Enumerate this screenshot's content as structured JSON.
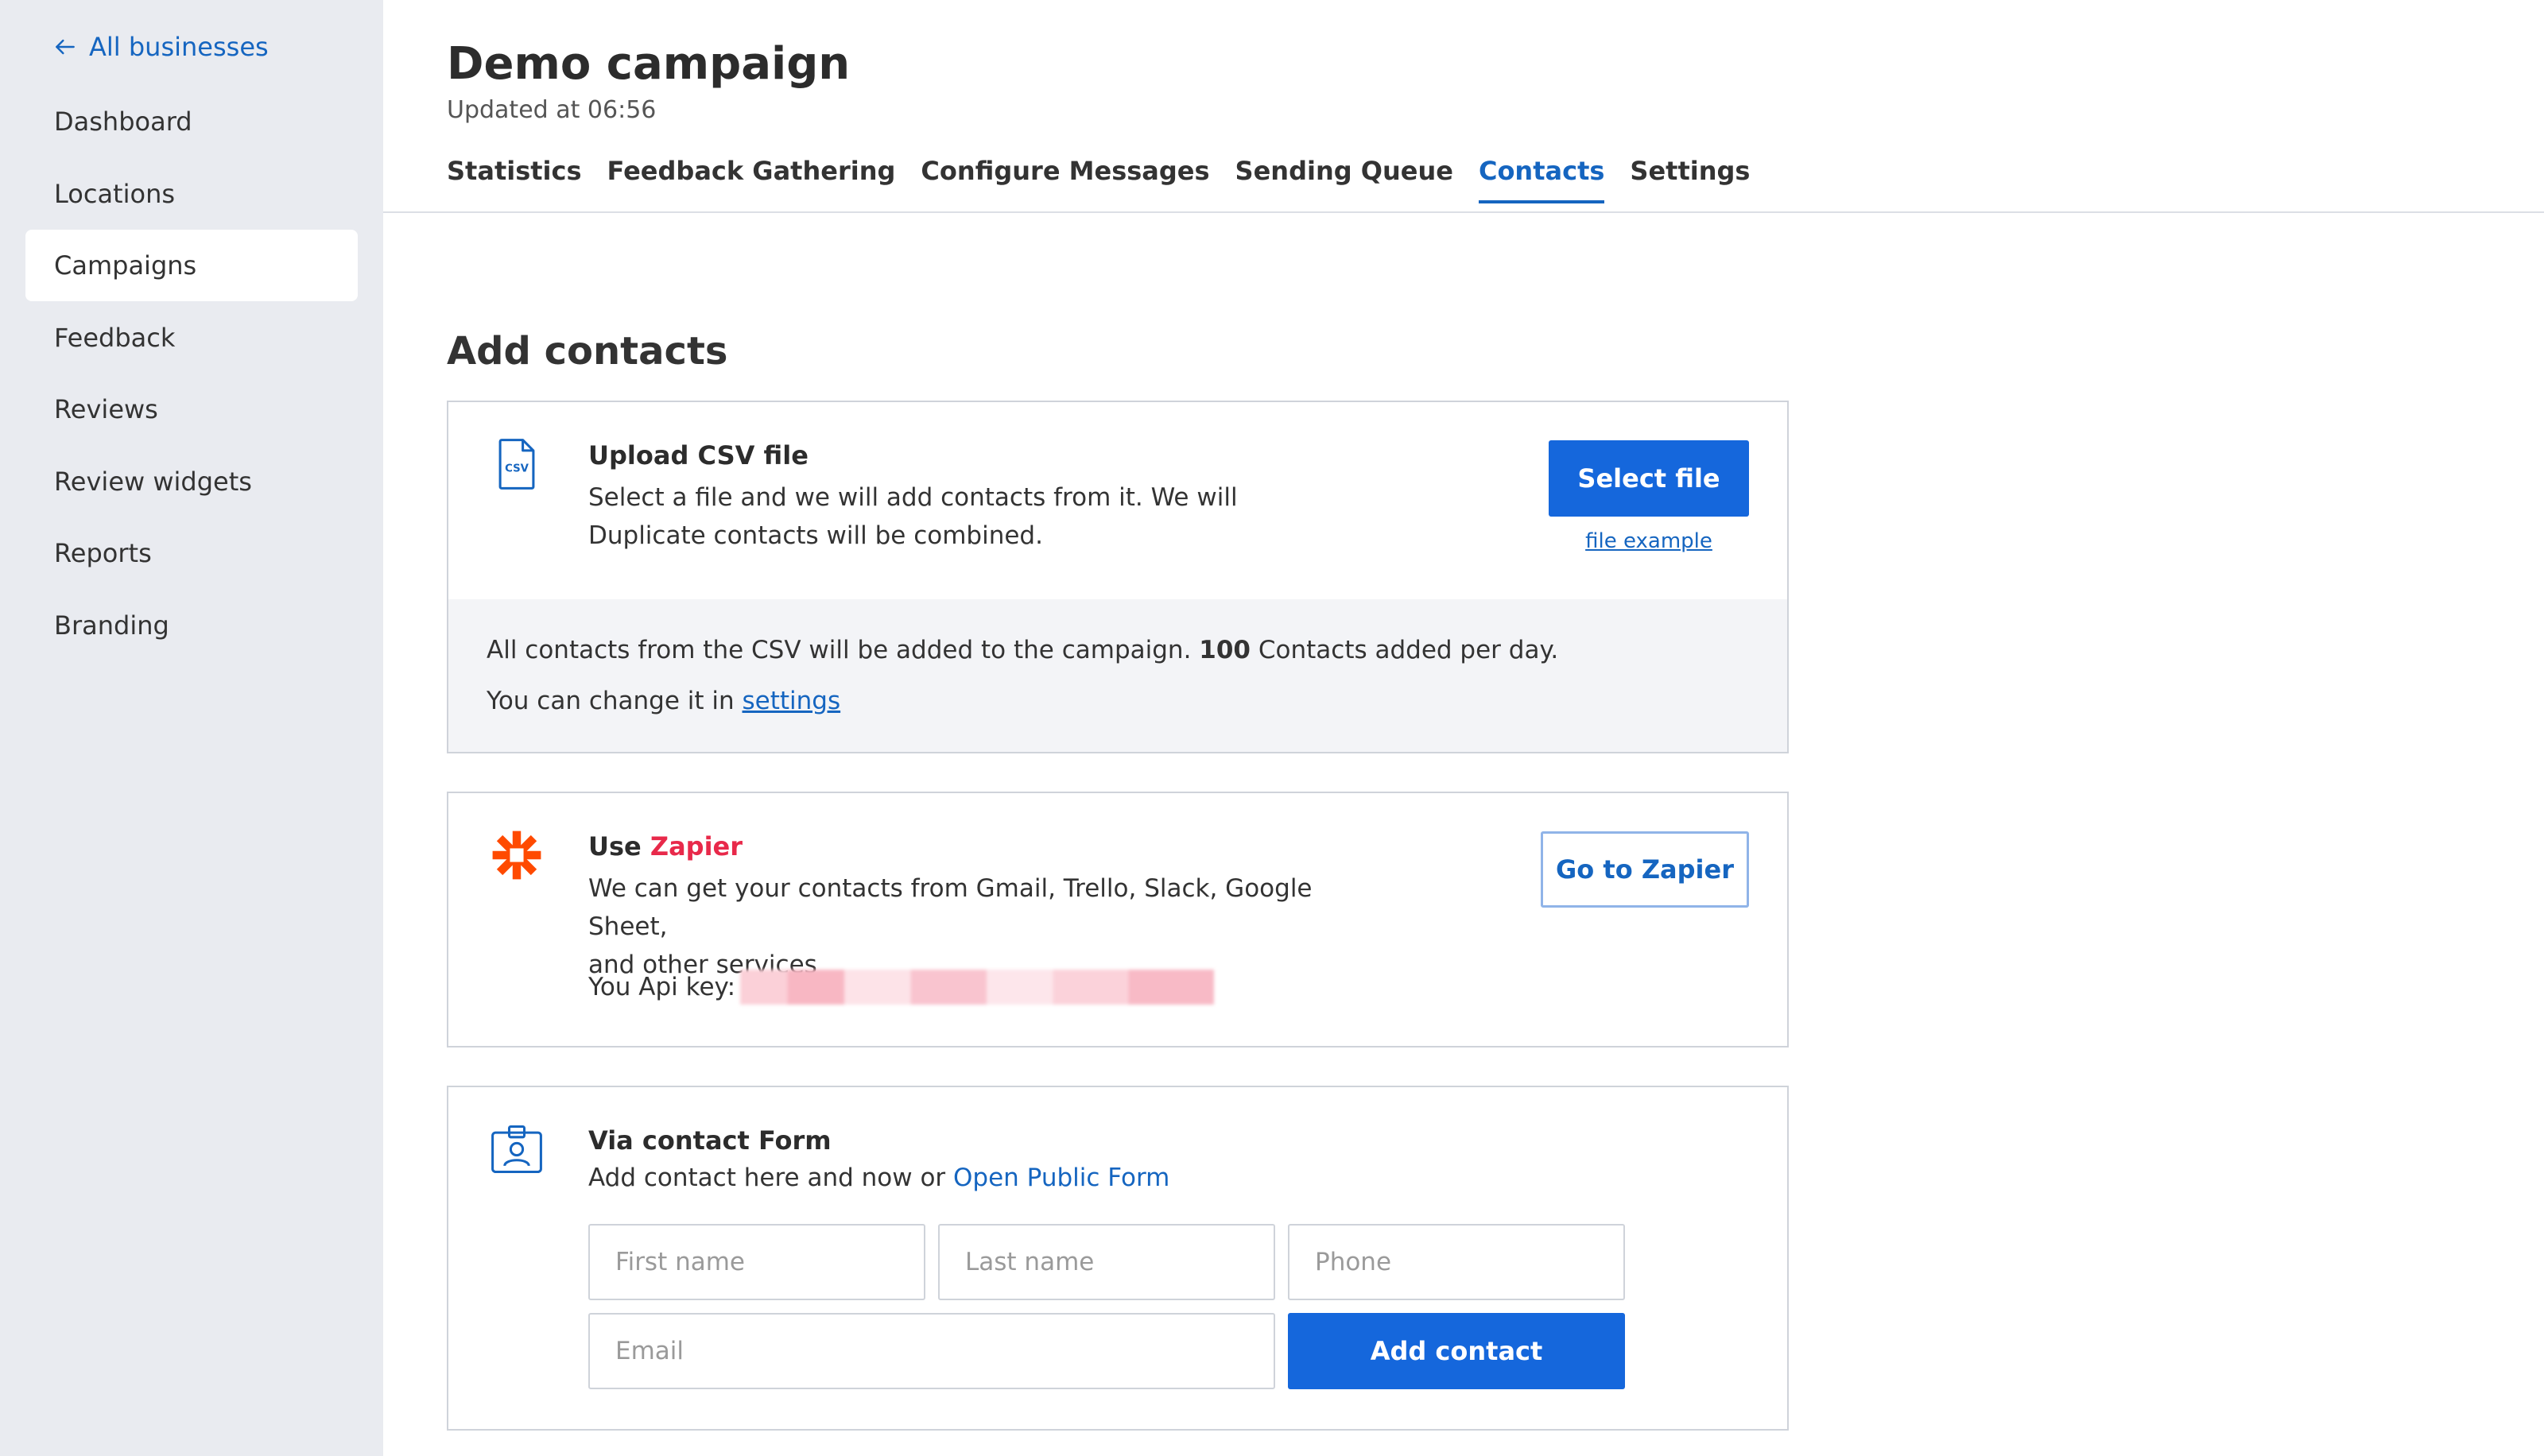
{
  "sidebar": {
    "back_label": "All businesses",
    "items": [
      {
        "label": "Dashboard"
      },
      {
        "label": "Locations"
      },
      {
        "label": "Campaigns",
        "active": true
      },
      {
        "label": "Feedback"
      },
      {
        "label": "Reviews"
      },
      {
        "label": "Review widgets"
      },
      {
        "label": "Reports"
      },
      {
        "label": "Branding"
      }
    ]
  },
  "header": {
    "title": "Demo campaign",
    "updated": "Updated at 06:56"
  },
  "tabs": [
    {
      "label": "Statistics"
    },
    {
      "label": "Feedback Gathering"
    },
    {
      "label": "Configure Messages"
    },
    {
      "label": "Sending Queue"
    },
    {
      "label": "Contacts",
      "active": true
    },
    {
      "label": "Settings"
    }
  ],
  "main": {
    "section_title": "Add contacts",
    "csv": {
      "icon": "csv-file-icon",
      "title": "Upload CSV file",
      "desc_line1": "Select a file and we will add contacts from it. We will",
      "desc_line2": "Duplicate contacts will be combined.",
      "select_button": "Select file",
      "file_example": "file example",
      "foot_pre": "All contacts from the CSV will be added to the campaign.",
      "foot_count": "100",
      "foot_post": "Contacts added per day.",
      "foot_line2_pre": "You can change it in",
      "foot_link": "settings"
    },
    "zapier": {
      "icon": "zapier-icon",
      "title_pre": "Use",
      "title_brand": "Zapier",
      "desc_line1": "We can get your contacts from Gmail, Trello, Slack, Google Sheet,",
      "desc_line2": "and other services",
      "api_label": "You Api key:",
      "button": "Go to Zapier",
      "brand_color": "#e8294a"
    },
    "form": {
      "icon": "contact-card-icon",
      "title": "Via contact Form",
      "desc_pre": "Add contact here and now or",
      "desc_link": "Open Public Form",
      "first_name_placeholder": "First name",
      "last_name_placeholder": "Last name",
      "phone_placeholder": "Phone",
      "email_placeholder": "Email",
      "add_button": "Add contact"
    }
  },
  "colors": {
    "accent": "#1565c0",
    "primary_button": "#1567dc",
    "sidebar_bg": "#e9ebf0"
  }
}
